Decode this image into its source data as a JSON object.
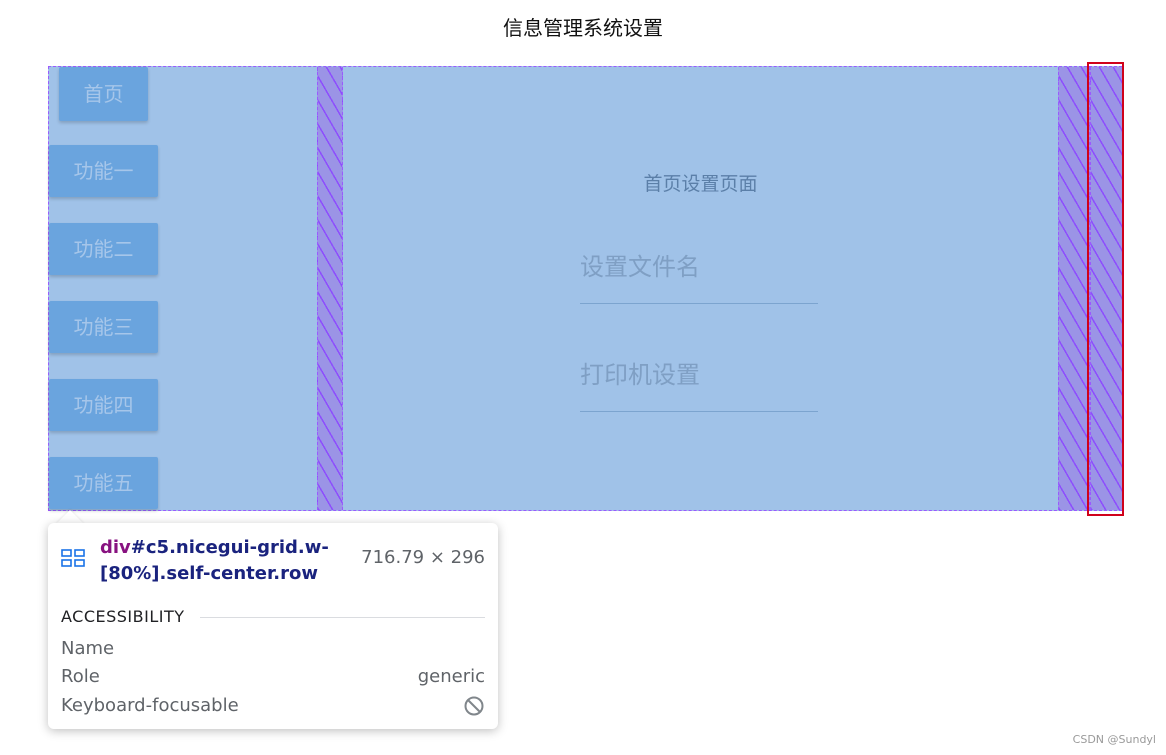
{
  "page": {
    "title": "信息管理系统设置"
  },
  "nav": {
    "items": [
      {
        "label": "首页"
      },
      {
        "label": "功能一"
      },
      {
        "label": "功能二"
      },
      {
        "label": "功能三"
      },
      {
        "label": "功能四"
      },
      {
        "label": "功能五"
      }
    ]
  },
  "content": {
    "heading": "首页设置页面",
    "fields": [
      {
        "label": "设置文件名",
        "value": ""
      },
      {
        "label": "打印机设置",
        "value": ""
      }
    ]
  },
  "inspector": {
    "tag": "div",
    "selector": "#c5.nicegui-grid.w-[80%].self-center.row",
    "dimensions": "716.79 × 296",
    "section": "ACCESSIBILITY",
    "rows": [
      {
        "key": "Name",
        "value": ""
      },
      {
        "key": "Role",
        "value": "generic"
      },
      {
        "key": "Keyboard-focusable",
        "value": ""
      }
    ],
    "icons": {
      "element_type": "grid-layout-icon",
      "focusable_status": "not-allowed-icon"
    }
  },
  "watermark": "CSDN @Sundyl",
  "colors": {
    "grid_overlay": "#a0c2e8",
    "gap_hatch": "#9b94e6",
    "dashed_border": "#9b59ff",
    "highlight": "#d0021b",
    "button": "#6aa4de",
    "selector_class": "#1a237e",
    "selector_tag": "#881280"
  }
}
